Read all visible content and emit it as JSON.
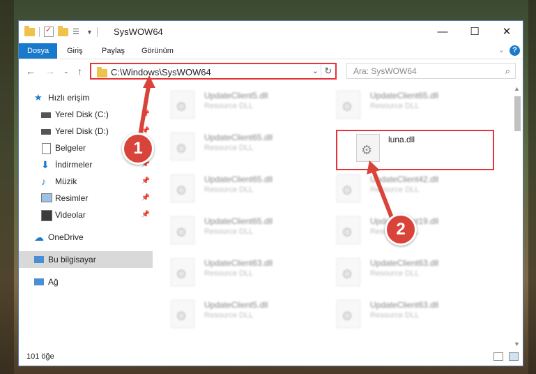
{
  "window": {
    "title": "SysWOW64"
  },
  "window_controls": {
    "minimize": "—",
    "maximize": "☐",
    "close": "✕"
  },
  "ribbon": {
    "tabs": [
      {
        "label": "Dosya"
      },
      {
        "label": "Giriş"
      },
      {
        "label": "Paylaş"
      },
      {
        "label": "Görünüm"
      }
    ],
    "help": "?"
  },
  "nav": {
    "address": "C:\\Windows\\SysWOW64",
    "search_placeholder": "Ara: SysWOW64"
  },
  "sidebar": {
    "items": [
      {
        "label": "Hızlı erişim",
        "icon": "star-icon"
      },
      {
        "label": "Yerel Disk (C:)",
        "icon": "drive-icon",
        "pinned": true
      },
      {
        "label": "Yerel Disk (D:)",
        "icon": "drive-icon",
        "pinned": true
      },
      {
        "label": "Belgeler",
        "icon": "documents-icon",
        "pinned": true
      },
      {
        "label": "İndirmeler",
        "icon": "downloads-icon",
        "pinned": true
      },
      {
        "label": "Müzik",
        "icon": "music-icon",
        "pinned": true
      },
      {
        "label": "Resimler",
        "icon": "pictures-icon",
        "pinned": true
      },
      {
        "label": "Videolar",
        "icon": "videos-icon",
        "pinned": true
      },
      {
        "label": "OneDrive",
        "icon": "cloud-icon"
      },
      {
        "label": "Bu bilgisayar",
        "icon": "computer-icon",
        "selected": true
      },
      {
        "label": "Ağ",
        "icon": "network-icon"
      }
    ]
  },
  "files": [
    {
      "name": "UpdateClient5.dll",
      "type": "Resource DLL"
    },
    {
      "name": "UpdateClient65.dll",
      "type": "Resource DLL"
    },
    {
      "name": "UpdateClient65.dll",
      "type": "Resource DLL"
    },
    {
      "name": "luna.dll",
      "type": ""
    },
    {
      "name": "UpdateClient65.dll",
      "type": "Resource DLL"
    },
    {
      "name": "UpdateClient42.dll",
      "type": "Resource DLL"
    },
    {
      "name": "UpdateClient65.dll",
      "type": "Resource DLL"
    },
    {
      "name": "UpdateClient19.dll",
      "type": "Resource DLL"
    },
    {
      "name": "UpdateClient63.dll",
      "type": "Resource DLL"
    },
    {
      "name": "UpdateClient63.dll",
      "type": "Resource DLL"
    },
    {
      "name": "UpdateClient5.dll",
      "type": "Resource DLL"
    },
    {
      "name": "UpdateClient63.dll",
      "type": "Resource DLL"
    }
  ],
  "status": {
    "count": "101 öğe"
  },
  "annotations": [
    {
      "number": "1"
    },
    {
      "number": "2"
    }
  ],
  "colors": {
    "accent": "#1979ca",
    "highlight": "#e5333a",
    "badge": "#d9443a"
  }
}
